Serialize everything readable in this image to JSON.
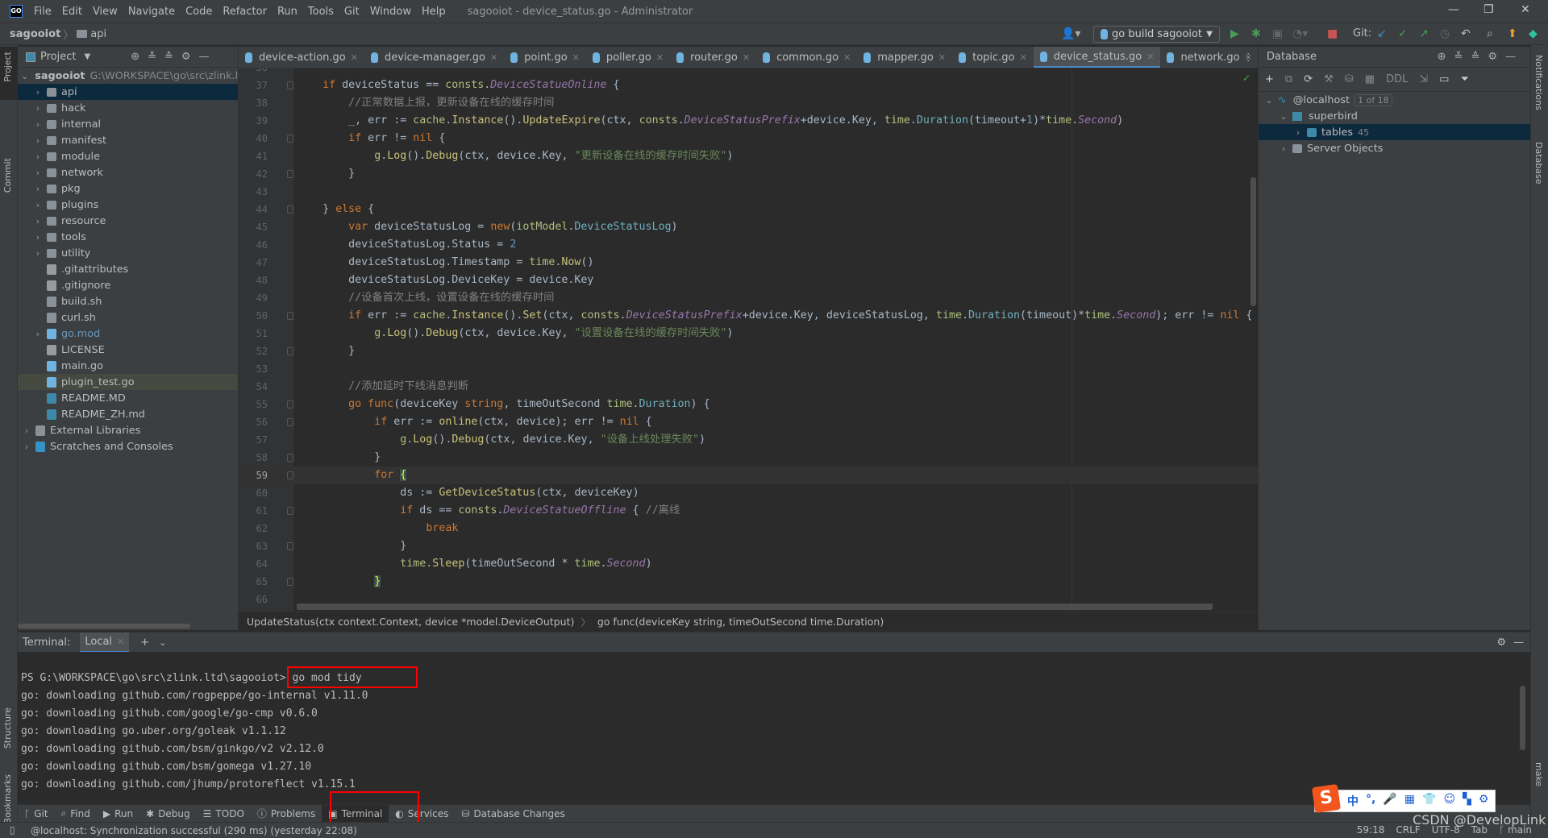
{
  "menubar": {
    "items": [
      "File",
      "Edit",
      "View",
      "Navigate",
      "Code",
      "Refactor",
      "Run",
      "Tools",
      "Git",
      "Window",
      "Help"
    ],
    "title": "sagooiot - device_status.go - Administrator"
  },
  "navbar": {
    "project": "sagooiot",
    "folder": "api"
  },
  "toolbar": {
    "run_config": "go build sagooiot",
    "git_label": "Git:"
  },
  "left_strip": {
    "project": "Project",
    "commit": "Commit",
    "structure": "Structure",
    "bookmarks": "Bookmarks"
  },
  "right_strip": {
    "notifications": "Notifications",
    "database": "Database",
    "make": "make"
  },
  "project": {
    "title": "Project",
    "root": "sagooiot",
    "root_path": "G:\\WORKSPACE\\go\\src\\zlink.ltd\\sagooiot",
    "items": [
      {
        "label": "api",
        "type": "folder",
        "expandable": true,
        "selected": true
      },
      {
        "label": "hack",
        "type": "folder",
        "expandable": true
      },
      {
        "label": "internal",
        "type": "folder",
        "expandable": true
      },
      {
        "label": "manifest",
        "type": "folder",
        "expandable": true
      },
      {
        "label": "module",
        "type": "folder",
        "expandable": true
      },
      {
        "label": "network",
        "type": "folder",
        "expandable": true
      },
      {
        "label": "pkg",
        "type": "folder",
        "expandable": true
      },
      {
        "label": "plugins",
        "type": "folder",
        "expandable": true
      },
      {
        "label": "resource",
        "type": "folder",
        "expandable": true
      },
      {
        "label": "tools",
        "type": "folder",
        "expandable": true
      },
      {
        "label": "utility",
        "type": "folder",
        "expandable": true
      },
      {
        "label": ".gitattributes",
        "type": "text"
      },
      {
        "label": ".gitignore",
        "type": "ignore"
      },
      {
        "label": "build.sh",
        "type": "shell"
      },
      {
        "label": "curl.sh",
        "type": "shell"
      },
      {
        "label": "go.mod",
        "type": "gomod",
        "expandable": true
      },
      {
        "label": "LICENSE",
        "type": "text"
      },
      {
        "label": "main.go",
        "type": "go"
      },
      {
        "label": "plugin_test.go",
        "type": "gotest",
        "highlighted": true
      },
      {
        "label": "README.MD",
        "type": "md"
      },
      {
        "label": "README_ZH.md",
        "type": "md"
      }
    ],
    "extra": [
      {
        "label": "External Libraries"
      },
      {
        "label": "Scratches and Consoles"
      }
    ]
  },
  "tabs": [
    {
      "label": "device-action.go"
    },
    {
      "label": "device-manager.go"
    },
    {
      "label": "point.go"
    },
    {
      "label": "poller.go"
    },
    {
      "label": "router.go"
    },
    {
      "label": "common.go"
    },
    {
      "label": "mapper.go"
    },
    {
      "label": "topic.go"
    },
    {
      "label": "device_status.go",
      "active": true
    },
    {
      "label": "network.go"
    }
  ],
  "editor": {
    "current_line": 59,
    "lines": [
      {
        "n": 36,
        "t": ""
      },
      {
        "n": 37,
        "t": "    if deviceStatus == consts.DeviceStatueOnline {"
      },
      {
        "n": 38,
        "t": "        //正常数据上报，更新设备在线的缓存时间"
      },
      {
        "n": 39,
        "t": "        _, err := cache.Instance().UpdateExpire(ctx, consts.DeviceStatusPrefix+device.Key, time.Duration(timeout+1)*time.Second)"
      },
      {
        "n": 40,
        "t": "        if err != nil {"
      },
      {
        "n": 41,
        "t": "            g.Log().Debug(ctx, device.Key, \"更新设备在线的缓存时间失败\")"
      },
      {
        "n": 42,
        "t": "        }"
      },
      {
        "n": 43,
        "t": ""
      },
      {
        "n": 44,
        "t": "    } else {"
      },
      {
        "n": 45,
        "t": "        var deviceStatusLog = new(iotModel.DeviceStatusLog)"
      },
      {
        "n": 46,
        "t": "        deviceStatusLog.Status = 2"
      },
      {
        "n": 47,
        "t": "        deviceStatusLog.Timestamp = time.Now()"
      },
      {
        "n": 48,
        "t": "        deviceStatusLog.DeviceKey = device.Key"
      },
      {
        "n": 49,
        "t": "        //设备首次上线，设置设备在线的缓存时间"
      },
      {
        "n": 50,
        "t": "        if err := cache.Instance().Set(ctx, consts.DeviceStatusPrefix+device.Key, deviceStatusLog, time.Duration(timeout)*time.Second); err != nil {"
      },
      {
        "n": 51,
        "t": "            g.Log().Debug(ctx, device.Key, \"设置设备在线的缓存时间失败\")"
      },
      {
        "n": 52,
        "t": "        }"
      },
      {
        "n": 53,
        "t": ""
      },
      {
        "n": 54,
        "t": "        //添加延时下线消息判断"
      },
      {
        "n": 55,
        "t": "        go func(deviceKey string, timeOutSecond time.Duration) {"
      },
      {
        "n": 56,
        "t": "            if err := online(ctx, device); err != nil {"
      },
      {
        "n": 57,
        "t": "                g.Log().Debug(ctx, device.Key, \"设备上线处理失败\")"
      },
      {
        "n": 58,
        "t": "            }"
      },
      {
        "n": 59,
        "t": "            for {"
      },
      {
        "n": 60,
        "t": "                ds := GetDeviceStatus(ctx, deviceKey)"
      },
      {
        "n": 61,
        "t": "                if ds == consts.DeviceStatueOffline { //离线"
      },
      {
        "n": 62,
        "t": "                    break"
      },
      {
        "n": 63,
        "t": "                }"
      },
      {
        "n": 64,
        "t": "                time.Sleep(timeOutSecond * time.Second)"
      },
      {
        "n": 65,
        "t": "            }"
      },
      {
        "n": 66,
        "t": ""
      }
    ]
  },
  "breadcrumbs": [
    "UpdateStatus(ctx context.Context, device *model.DeviceOutput)",
    "go func(deviceKey string, timeOutSecond time.Duration)"
  ],
  "database": {
    "title": "Database",
    "ddl": "DDL",
    "host": "@localhost",
    "host_badge": "1 of 18",
    "schema": "superbird",
    "tables": "tables",
    "tables_count": "45",
    "server_objects": "Server Objects"
  },
  "terminal": {
    "label": "Terminal:",
    "tab": "Local",
    "prompt": "PS G:\\WORKSPACE\\go\\src\\zlink.ltd\\sagooiot>",
    "command": " go mod tidy",
    "output": [
      "go: downloading github.com/rogpeppe/go-internal v1.11.0",
      "go: downloading github.com/google/go-cmp v0.6.0",
      "go: downloading go.uber.org/goleak v1.1.12",
      "go: downloading github.com/bsm/ginkgo/v2 v2.12.0",
      "go: downloading github.com/bsm/gomega v1.27.10",
      "go: downloading github.com/jhump/protoreflect v1.15.1"
    ]
  },
  "bottom_tabs": [
    {
      "label": "Git",
      "icon": "git-branch-icon"
    },
    {
      "label": "Find",
      "icon": "search-icon"
    },
    {
      "label": "Run",
      "icon": "play-icon"
    },
    {
      "label": "Debug",
      "icon": "bug-icon"
    },
    {
      "label": "TODO",
      "icon": "list-icon"
    },
    {
      "label": "Problems",
      "icon": "warning-icon"
    },
    {
      "label": "Terminal",
      "icon": "terminal-icon",
      "active": true
    },
    {
      "label": "Services",
      "icon": "services-icon"
    },
    {
      "label": "Database Changes",
      "icon": "database-icon"
    }
  ],
  "status": {
    "message": "@localhost: Synchronization successful (290 ms) (yesterday 22:08)",
    "position": "59:18",
    "line_sep": "CRLF",
    "encoding": "UTF-8",
    "indent": "Tab",
    "branch": "main"
  },
  "ime": {
    "logo": "S",
    "items": [
      "中",
      "°,",
      "🎤",
      "▦",
      "👕",
      "☺",
      "▚",
      "⚙"
    ]
  },
  "watermark": "CSDN @DevelopLink",
  "colors": {
    "accent": "#4a88c7",
    "highlight_box": "#ff0000",
    "keyword": "#cc7832",
    "string": "#6a8759",
    "constant": "#9876aa"
  }
}
